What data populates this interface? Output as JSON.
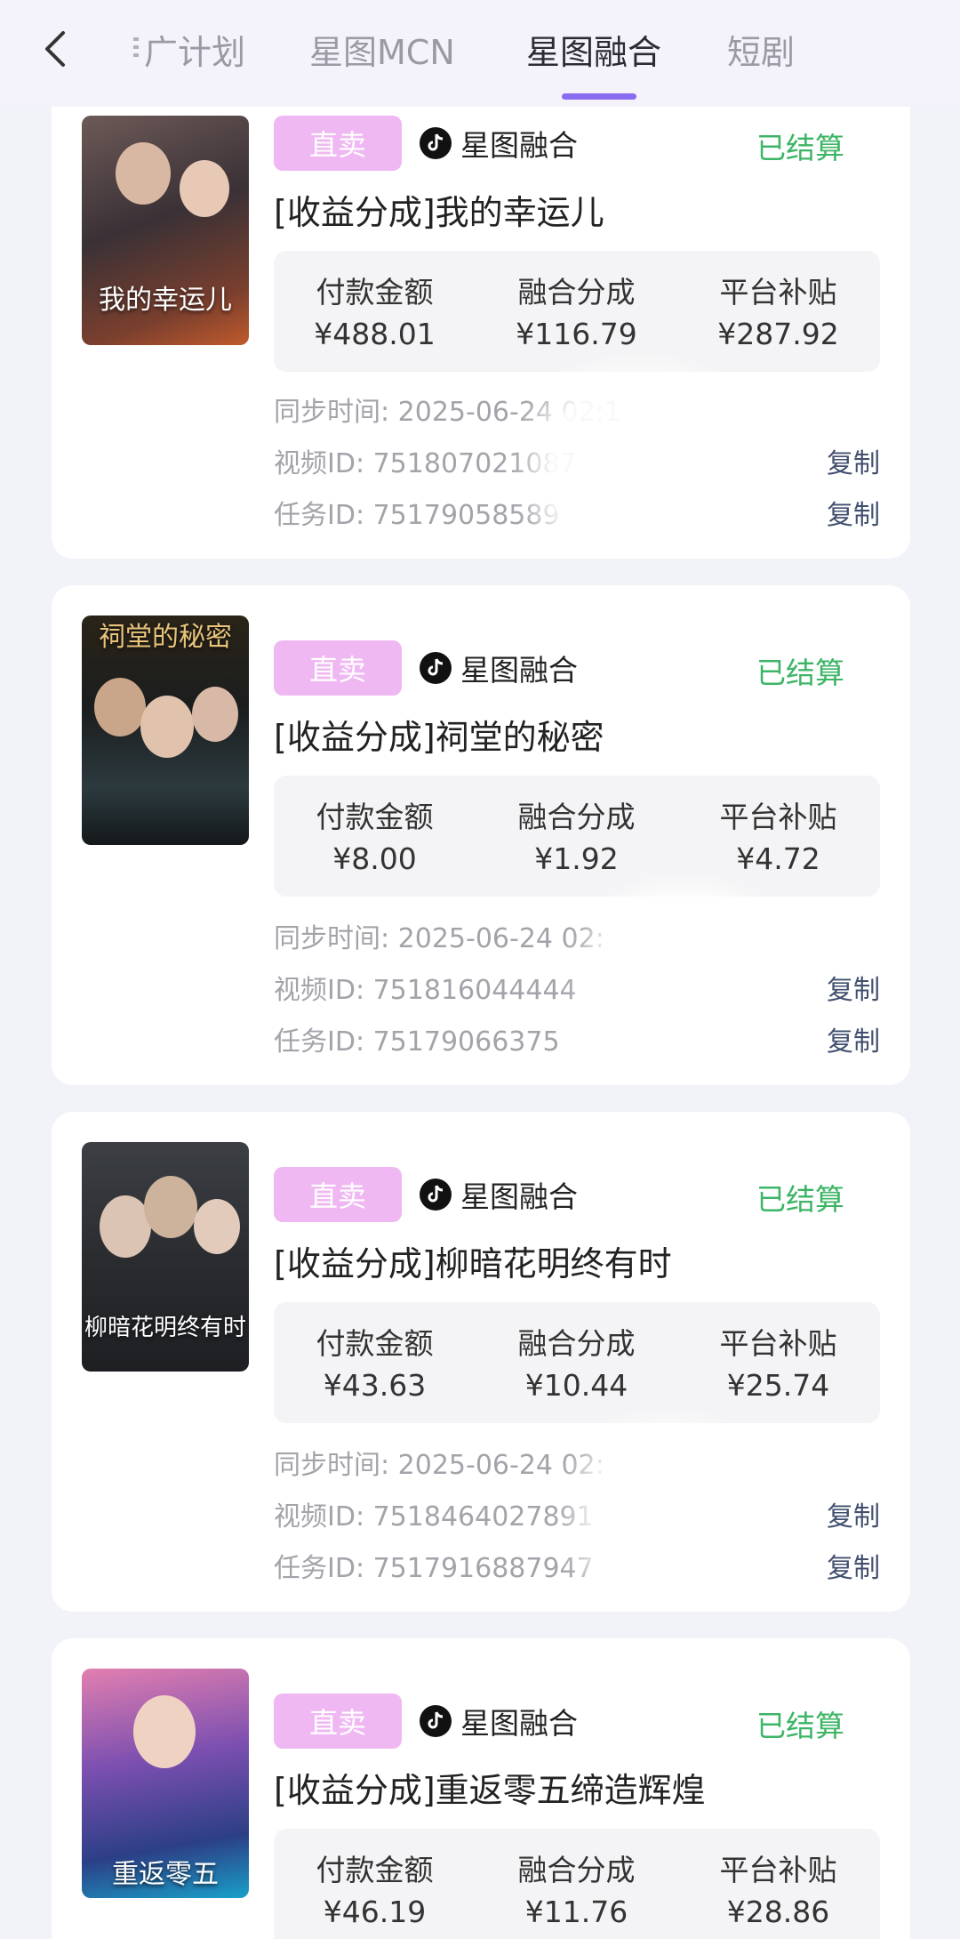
{
  "tabs": [
    {
      "label": "广计划"
    },
    {
      "label": "星图MCN"
    },
    {
      "label": "星图融合"
    },
    {
      "label": "短剧"
    }
  ],
  "active_tab": "星图融合",
  "labels": {
    "badge": "直卖",
    "platform": "星图融合",
    "status": "已结算",
    "pay_label": "付款金额",
    "share_label": "融合分成",
    "subsidy_label": "平台补贴",
    "copy": "复制"
  },
  "cards": [
    {
      "poster_title": "我的幸运儿",
      "title": "[收益分成]我的幸运儿",
      "pay": "¥488.01",
      "share": "¥116.79",
      "subsidy": "¥287.92",
      "sync_time": "同步时间: 2025-06-24 02:1",
      "video_id": "视频ID: 751807021087",
      "task_id": "任务ID: 75179058589"
    },
    {
      "poster_title": "祠堂的秘密",
      "title": "[收益分成]祠堂的秘密",
      "pay": "¥8.00",
      "share": "¥1.92",
      "subsidy": "¥4.72",
      "sync_time": "同步时间: 2025-06-24 02:",
      "video_id": "视频ID: 751816044444",
      "task_id": "任务ID: 75179066375"
    },
    {
      "poster_title": "柳暗花明终有时",
      "title": "[收益分成]柳暗花明终有时",
      "pay": "¥43.63",
      "share": "¥10.44",
      "subsidy": "¥25.74",
      "sync_time": "同步时间: 2025-06-24 02:",
      "video_id": "视频ID: 7518464027891",
      "task_id": "任务ID: 7517916887947"
    },
    {
      "poster_title": "重返零五",
      "title": "[收益分成]重返零五缔造辉煌",
      "pay": "¥46.19",
      "share": "¥11.76",
      "subsidy": "¥28.86",
      "sync_time": "",
      "video_id": "",
      "task_id": ""
    }
  ],
  "colors": {
    "accent": "#8a6cf0",
    "badge": "#efb8f2",
    "settled": "#3db566",
    "copy_link": "#41506e"
  }
}
